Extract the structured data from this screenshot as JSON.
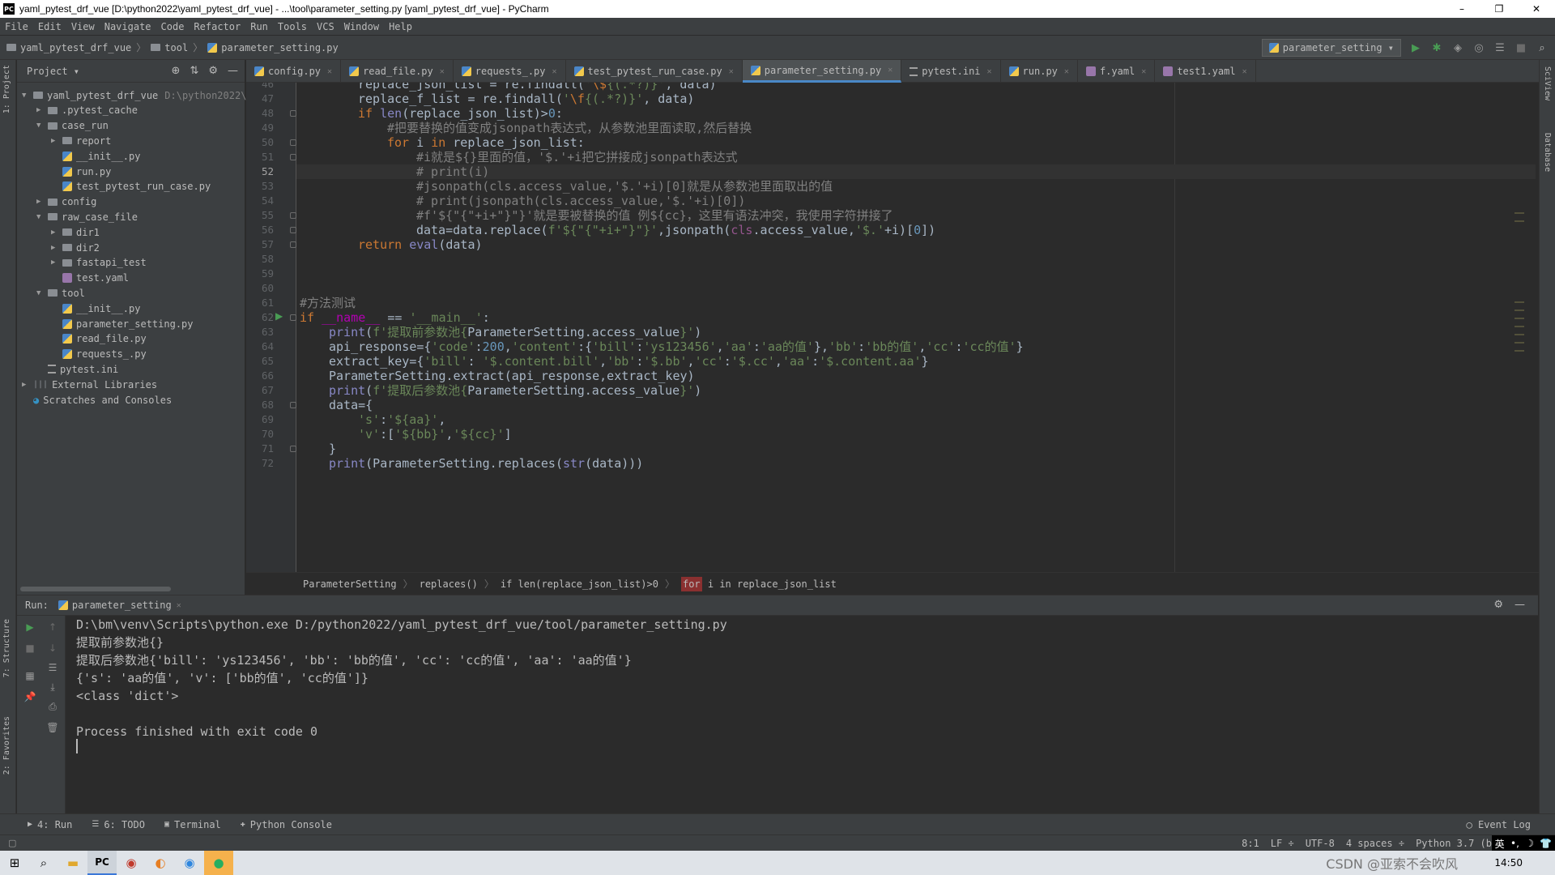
{
  "window": {
    "title": "yaml_pytest_drf_vue [D:\\python2022\\yaml_pytest_drf_vue] - ...\\tool\\parameter_setting.py [yaml_pytest_drf_vue] - PyCharm",
    "app_icon": "PC",
    "controls": [
      "–",
      "❐",
      "✕"
    ]
  },
  "menu": [
    "File",
    "Edit",
    "View",
    "Navigate",
    "Code",
    "Refactor",
    "Run",
    "Tools",
    "VCS",
    "Window",
    "Help"
  ],
  "navbar": {
    "crumbs": [
      "yaml_pytest_drf_vue",
      "tool",
      "parameter_setting.py"
    ],
    "run_config": "parameter_setting ▾"
  },
  "project": {
    "title": "Project ▾",
    "tree": [
      {
        "label": "yaml_pytest_drf_vue",
        "path": "D:\\python2022\\",
        "depth": 0,
        "kind": "folder",
        "open": true
      },
      {
        "label": ".pytest_cache",
        "depth": 1,
        "kind": "folder",
        "open": false
      },
      {
        "label": "case_run",
        "depth": 1,
        "kind": "folder",
        "open": true
      },
      {
        "label": "report",
        "depth": 2,
        "kind": "folder",
        "open": false
      },
      {
        "label": "__init__.py",
        "depth": 2,
        "kind": "py"
      },
      {
        "label": "run.py",
        "depth": 2,
        "kind": "py"
      },
      {
        "label": "test_pytest_run_case.py",
        "depth": 2,
        "kind": "py"
      },
      {
        "label": "config",
        "depth": 1,
        "kind": "folder",
        "open": false
      },
      {
        "label": "raw_case_file",
        "depth": 1,
        "kind": "folder",
        "open": true
      },
      {
        "label": "dir1",
        "depth": 2,
        "kind": "folder",
        "open": false
      },
      {
        "label": "dir2",
        "depth": 2,
        "kind": "folder",
        "open": false
      },
      {
        "label": "fastapi_test",
        "depth": 2,
        "kind": "folder",
        "open": false
      },
      {
        "label": "test.yaml",
        "depth": 2,
        "kind": "yaml"
      },
      {
        "label": "tool",
        "depth": 1,
        "kind": "folder",
        "open": true
      },
      {
        "label": "__init__.py",
        "depth": 2,
        "kind": "py"
      },
      {
        "label": "parameter_setting.py",
        "depth": 2,
        "kind": "py"
      },
      {
        "label": "read_file.py",
        "depth": 2,
        "kind": "py"
      },
      {
        "label": "requests_.py",
        "depth": 2,
        "kind": "py"
      },
      {
        "label": "pytest.ini",
        "depth": 1,
        "kind": "ini"
      },
      {
        "label": "External Libraries",
        "depth": 0,
        "kind": "lib",
        "open": false
      },
      {
        "label": "Scratches and Consoles",
        "depth": 0,
        "kind": "scratch"
      }
    ]
  },
  "tabs": [
    {
      "label": "config.py",
      "kind": "py",
      "active": false
    },
    {
      "label": "read_file.py",
      "kind": "py",
      "active": false
    },
    {
      "label": "requests_.py",
      "kind": "py",
      "active": false
    },
    {
      "label": "test_pytest_run_case.py",
      "kind": "py",
      "active": false
    },
    {
      "label": "parameter_setting.py",
      "kind": "py",
      "active": true
    },
    {
      "label": "pytest.ini",
      "kind": "ini",
      "active": false
    },
    {
      "label": "run.py",
      "kind": "py",
      "active": false
    },
    {
      "label": "f.yaml",
      "kind": "yaml",
      "active": false
    },
    {
      "label": "test1.yaml",
      "kind": "yaml",
      "active": false
    }
  ],
  "editor": {
    "current_line": 52,
    "lines": [
      {
        "n": 46,
        "indent": 8,
        "parts": [
          [
            "replace_json_list = re.findall(",
            ""
          ],
          [
            "'",
            "str"
          ],
          [
            "\\$",
            "esc"
          ],
          [
            "{(.*?)}",
            "str"
          ],
          [
            "'",
            "str"
          ],
          [
            ", data)",
            ""
          ]
        ]
      },
      {
        "n": 47,
        "indent": 8,
        "parts": [
          [
            "replace_f_list",
            ""
          ],
          [
            " = re.findall(",
            ""
          ],
          [
            "'",
            "str"
          ],
          [
            "\\f",
            "esc"
          ],
          [
            "{(.*?)}",
            "str"
          ],
          [
            "'",
            "str"
          ],
          [
            ", data)",
            ""
          ]
        ]
      },
      {
        "n": 48,
        "indent": 8,
        "parts": [
          [
            "if ",
            "kw"
          ],
          [
            "len",
            "fn"
          ],
          [
            "(replace_json_list)>",
            ""
          ],
          [
            "0",
            "num"
          ],
          [
            ":",
            ""
          ]
        ]
      },
      {
        "n": 49,
        "indent": 12,
        "parts": [
          [
            "#把要替换的值变成jsonpath表达式，从参数池里面读取,然后替换",
            "cmt"
          ]
        ]
      },
      {
        "n": 50,
        "indent": 12,
        "parts": [
          [
            "for ",
            "kw"
          ],
          [
            "i ",
            ""
          ],
          [
            "in ",
            "kw"
          ],
          [
            "replace_json_list:",
            ""
          ]
        ]
      },
      {
        "n": 51,
        "indent": 16,
        "parts": [
          [
            "#i就是${}里面的值，'$.'+i把它拼接成jsonpath表达式",
            "cmt"
          ]
        ]
      },
      {
        "n": 52,
        "indent": 16,
        "parts": [
          [
            "# print(i)",
            "cmt"
          ]
        ]
      },
      {
        "n": 53,
        "indent": 16,
        "parts": [
          [
            "#jsonpath(cls.access_value,'$.'+i)[0]就是从参数池里面取出的值",
            "cmt"
          ]
        ]
      },
      {
        "n": 54,
        "indent": 16,
        "parts": [
          [
            "# print(jsonpath(cls.access_value,'$.'+i)[0])",
            "cmt"
          ]
        ]
      },
      {
        "n": 55,
        "indent": 16,
        "parts": [
          [
            "#f'${\"{\"+i+\"}\"}'就是要被替换的值 例${cc}，这里有语法冲突，我使用字符拼接了",
            "cmt"
          ]
        ]
      },
      {
        "n": 56,
        "indent": 16,
        "parts": [
          [
            "data=data.replace(",
            ""
          ],
          [
            "f'${\"{\"+i+\"}\"}'",
            "str"
          ],
          [
            ",jsonpath(",
            ""
          ],
          [
            "cls",
            "self"
          ],
          [
            ".access_value,",
            ""
          ],
          [
            "'$.'",
            "str"
          ],
          [
            "+i)[",
            ""
          ],
          [
            "0",
            "num"
          ],
          [
            "])",
            ""
          ]
        ]
      },
      {
        "n": 57,
        "indent": 8,
        "parts": [
          [
            "return ",
            "kw"
          ],
          [
            "eval",
            "fn"
          ],
          [
            "(data)",
            ""
          ]
        ]
      },
      {
        "n": 58,
        "indent": 0,
        "parts": []
      },
      {
        "n": 59,
        "indent": 0,
        "parts": []
      },
      {
        "n": 60,
        "indent": 0,
        "parts": []
      },
      {
        "n": 61,
        "indent": 0,
        "parts": [
          [
            "#方法测试",
            "cmt"
          ]
        ]
      },
      {
        "n": 62,
        "indent": 0,
        "parts": [
          [
            "if ",
            "kw"
          ],
          [
            "__name__",
            "dunder"
          ],
          [
            " == ",
            ""
          ],
          [
            "'__main__'",
            "str"
          ],
          [
            ":",
            ""
          ]
        ]
      },
      {
        "n": 63,
        "indent": 4,
        "parts": [
          [
            "print",
            "fn"
          ],
          [
            "(",
            ""
          ],
          [
            "f'提取前参数池{",
            "str"
          ],
          [
            "ParameterSetting.access_value",
            ""
          ],
          [
            "}'",
            "str"
          ],
          [
            ")",
            ""
          ]
        ]
      },
      {
        "n": 64,
        "indent": 4,
        "parts": [
          [
            "api_response={",
            ""
          ],
          [
            "'code'",
            "str"
          ],
          [
            ":",
            ""
          ],
          [
            "200",
            "num"
          ],
          [
            ",",
            ""
          ],
          [
            "'content'",
            "str"
          ],
          [
            ":{",
            ""
          ],
          [
            "'bill'",
            "str"
          ],
          [
            ":",
            ""
          ],
          [
            "'ys123456'",
            "str"
          ],
          [
            ",",
            ""
          ],
          [
            "'aa'",
            "str"
          ],
          [
            ":",
            ""
          ],
          [
            "'aa的值'",
            "str"
          ],
          [
            "},",
            ""
          ],
          [
            "'bb'",
            "str"
          ],
          [
            ":",
            ""
          ],
          [
            "'bb的值'",
            "str"
          ],
          [
            ",",
            ""
          ],
          [
            "'cc'",
            "str"
          ],
          [
            ":",
            ""
          ],
          [
            "'cc的值'",
            "str"
          ],
          [
            "}",
            ""
          ]
        ]
      },
      {
        "n": 65,
        "indent": 4,
        "parts": [
          [
            "extract_key={",
            ""
          ],
          [
            "'bill'",
            "str"
          ],
          [
            ": ",
            ""
          ],
          [
            "'$.content.bill'",
            "str"
          ],
          [
            ",",
            ""
          ],
          [
            "'bb'",
            "str"
          ],
          [
            ":",
            ""
          ],
          [
            "'$.bb'",
            "str"
          ],
          [
            ",",
            ""
          ],
          [
            "'cc'",
            "str"
          ],
          [
            ":",
            ""
          ],
          [
            "'$.cc'",
            "str"
          ],
          [
            ",",
            ""
          ],
          [
            "'aa'",
            "str"
          ],
          [
            ":",
            ""
          ],
          [
            "'$.content.aa'",
            "str"
          ],
          [
            "}",
            ""
          ]
        ]
      },
      {
        "n": 66,
        "indent": 4,
        "parts": [
          [
            "ParameterSetting.extract(api_response,extract_key)",
            ""
          ]
        ]
      },
      {
        "n": 67,
        "indent": 4,
        "parts": [
          [
            "print",
            "fn"
          ],
          [
            "(",
            ""
          ],
          [
            "f'提取后参数池{",
            "str"
          ],
          [
            "ParameterSetting.access_value",
            ""
          ],
          [
            "}'",
            "str"
          ],
          [
            ")",
            ""
          ]
        ]
      },
      {
        "n": 68,
        "indent": 4,
        "parts": [
          [
            "data={",
            ""
          ]
        ]
      },
      {
        "n": 69,
        "indent": 8,
        "parts": [
          [
            "'s'",
            "str"
          ],
          [
            ":",
            ""
          ],
          [
            "'${aa}'",
            "str"
          ],
          [
            ",",
            ""
          ]
        ]
      },
      {
        "n": 70,
        "indent": 8,
        "parts": [
          [
            "'v'",
            "str"
          ],
          [
            ":[",
            ""
          ],
          [
            "'${bb}'",
            "str"
          ],
          [
            ",",
            ""
          ],
          [
            "'${cc}'",
            "str"
          ],
          [
            "]",
            ""
          ]
        ]
      },
      {
        "n": 71,
        "indent": 4,
        "parts": [
          [
            "}",
            ""
          ]
        ]
      },
      {
        "n": 72,
        "indent": 4,
        "parts": [
          [
            "print",
            "fn"
          ],
          [
            "(ParameterSetting.replaces(",
            ""
          ],
          [
            "str",
            "fn"
          ],
          [
            "(data)))",
            ""
          ]
        ]
      }
    ]
  },
  "breadcrumb_bar": [
    "ParameterSetting",
    "replaces()",
    "if len(replace_json_list)>0",
    "for i in replace_json_list"
  ],
  "run_panel": {
    "label": "Run:",
    "tab": "parameter_setting",
    "output": [
      "D:\\bm\\venv\\Scripts\\python.exe D:/python2022/yaml_pytest_drf_vue/tool/parameter_setting.py",
      "提取前参数池{}",
      "提取后参数池{'bill': 'ys123456', 'bb': 'bb的值', 'cc': 'cc的值', 'aa': 'aa的值'}",
      "{'s': 'aa的值', 'v': ['bb的值', 'cc的值']}",
      "<class 'dict'>",
      "",
      "Process finished with exit code 0"
    ]
  },
  "bottom_tabs": [
    "4: Run",
    "6: TODO",
    "Terminal",
    "Python Console"
  ],
  "event_log": "Event Log",
  "status": [
    "8:1",
    "LF ÷",
    "UTF-8",
    "4 spaces ÷",
    "Python 3.7 (b"
  ],
  "side_labels": {
    "left_top": "1: Project",
    "left_mid": "7: Structure",
    "left_bottom": "2: Favorites",
    "right_top": "SciView",
    "right_mid": "Database"
  },
  "ime": [
    "英",
    "•,",
    "☽",
    "👕"
  ],
  "taskbar": {
    "watermark": "CSDN @亚索不会吹风",
    "clock": "14:50"
  }
}
